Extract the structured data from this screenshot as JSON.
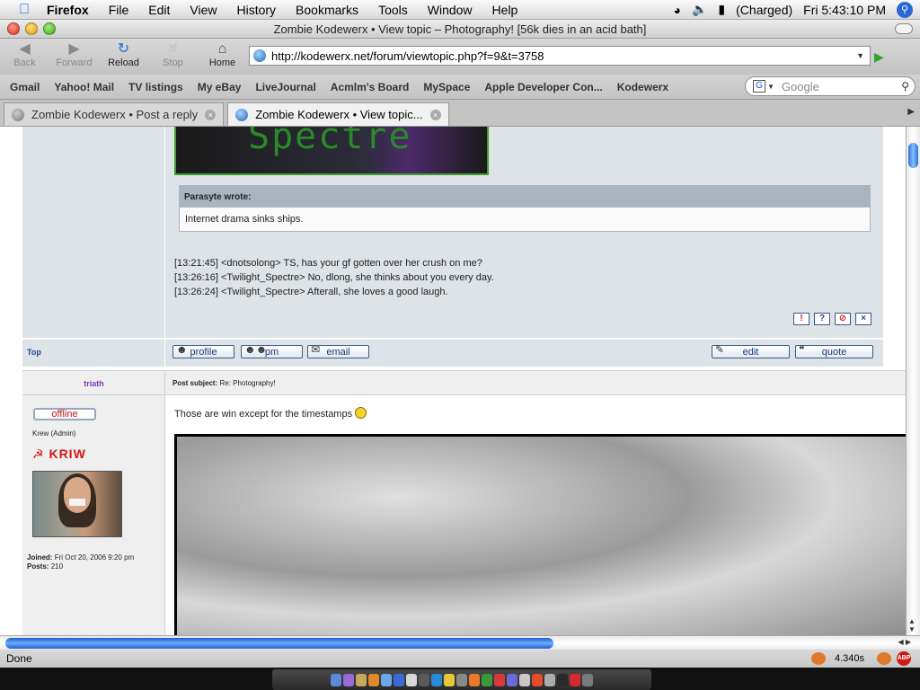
{
  "menubar": {
    "app_name": "Firefox",
    "menus": [
      "File",
      "Edit",
      "View",
      "History",
      "Bookmarks",
      "Tools",
      "Window",
      "Help"
    ],
    "battery": "(Charged)",
    "clock": "Fri 5:43:10 PM"
  },
  "window": {
    "title": "Zombie Kodewerx • View topic – Photography! [56k dies in an acid bath]"
  },
  "nav": {
    "back": "Back",
    "forward": "Forward",
    "reload": "Reload",
    "stop": "Stop",
    "home": "Home",
    "url": "http://kodewerx.net/forum/viewtopic.php?f=9&t=3758"
  },
  "bookmarks": [
    "Gmail",
    "Yahoo! Mail",
    "TV listings",
    "My eBay",
    "LiveJournal",
    "Acmlm's Board",
    "MySpace",
    "Apple Developer Con...",
    "Kodewerx"
  ],
  "search": {
    "placeholder": "Google"
  },
  "tabs": [
    {
      "label": "Zombie Kodewerx • Post a reply",
      "active": false
    },
    {
      "label": "Zombie Kodewerx • View topic...",
      "active": true
    }
  ],
  "post1": {
    "banner_text": "Spectre",
    "quote_author": "Parasyte wrote:",
    "quote_body": "Internet drama sinks ships.",
    "chat": [
      "[13:21:45] <dnotsolong> TS, has your gf gotten over her crush on me?",
      "[13:26:16] <Twilight_Spectre> No, dlong, she thinks about you every day.",
      "[13:26:24] <Twilight_Spectre> Afterall, she loves a good laugh."
    ]
  },
  "actions": {
    "top": "Top",
    "profile": "profile",
    "pm": "pm",
    "email": "email",
    "edit": "edit",
    "quote": "quote"
  },
  "post2": {
    "author": "triath",
    "subject_label": "Post subject:",
    "subject": "Re: Photography!",
    "status": "offline",
    "rank": "Krew (Admin)",
    "rank_image_text": "KRIW",
    "joined_label": "Joined:",
    "joined": "Fri Oct 20, 2006 9:20 pm",
    "posts_label": "Posts:",
    "posts": "210",
    "message": "Those are win except for the timestamps"
  },
  "status": {
    "text": "Done",
    "timing": "4.340s",
    "adblock": "ABP"
  },
  "colors": {
    "post_bg": "#dee3e7",
    "quote_header": "#aab4bf",
    "author_purple": "#7a3ab0",
    "link_blue": "#1a4a8a"
  }
}
